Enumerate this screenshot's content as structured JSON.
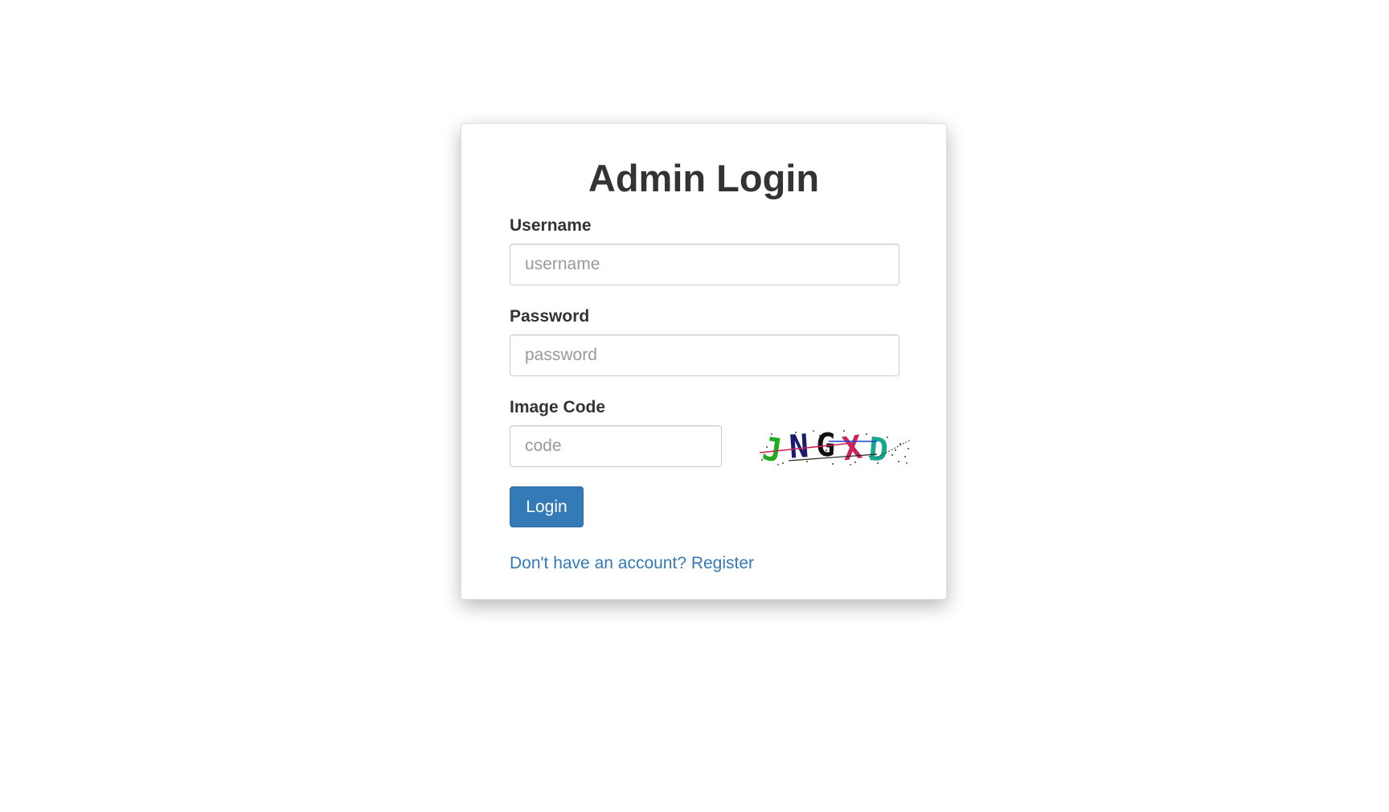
{
  "title": "Admin Login",
  "form": {
    "username": {
      "label": "Username",
      "placeholder": "username",
      "value": ""
    },
    "password": {
      "label": "Password",
      "placeholder": "password",
      "value": ""
    },
    "code": {
      "label": "Image Code",
      "placeholder": "code",
      "value": ""
    },
    "captcha": {
      "text": "JNGXD",
      "colors": [
        "#22aa22",
        "#1a1a6e",
        "#111111",
        "#cc2255",
        "#14a88c"
      ]
    }
  },
  "login_button": "Login",
  "register_link": "Don't have an account? Register",
  "colors": {
    "primary": "#337ab7",
    "text": "#333333",
    "border": "#cccccc"
  }
}
